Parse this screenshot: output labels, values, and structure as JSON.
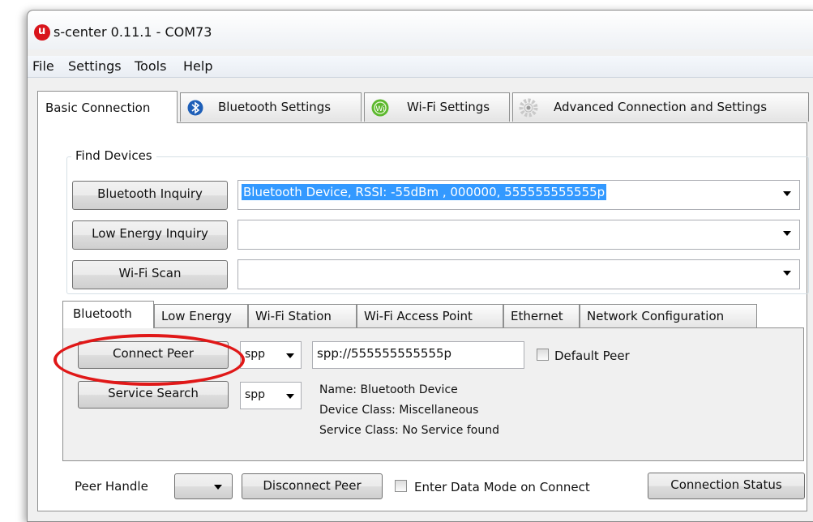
{
  "window": {
    "title": "s-center 0.11.1 - COM73"
  },
  "menu": [
    "File",
    "Settings",
    "Tools",
    "Help"
  ],
  "tabs": [
    {
      "label": "Basic Connection",
      "icon": ""
    },
    {
      "label": "Bluetooth Settings",
      "icon": "bluetooth-icon"
    },
    {
      "label": "Wi-Fi Settings",
      "icon": "wifi-icon"
    },
    {
      "label": "Advanced Connection and Settings",
      "icon": "gear-icon"
    }
  ],
  "find_devices": {
    "legend": "Find Devices",
    "bluetooth_inquiry": {
      "button": "Bluetooth Inquiry",
      "value": "Bluetooth Device, RSSI: -55dBm , 000000, 555555555555p"
    },
    "low_energy_inquiry": {
      "button": "Low Energy Inquiry",
      "value": ""
    },
    "wifi_scan": {
      "button": "Wi-Fi Scan",
      "value": ""
    }
  },
  "subtabs": [
    "Bluetooth",
    "Low Energy",
    "Wi-Fi Station",
    "Wi-Fi Access Point",
    "Ethernet",
    "Network Configuration"
  ],
  "bluetooth_panel": {
    "connect_peer_button": "Connect Peer",
    "connect_protocol": "spp",
    "peer_address": "spp://555555555555p",
    "default_peer_label": "Default Peer",
    "service_search_button": "Service Search",
    "search_protocol": "spp",
    "info": {
      "name": "Name: Bluetooth Device",
      "device_class": "Device Class: Miscellaneous",
      "service_class": "Service Class: No Service found"
    }
  },
  "bottom": {
    "peer_handle_label": "Peer Handle",
    "peer_handle_value": "",
    "disconnect_button": "Disconnect Peer",
    "enter_data_mode_label": "Enter Data Mode on Connect",
    "connection_status_button": "Connection Status"
  },
  "colors": {
    "highlight": "#3399ff",
    "annotation_circle": "#e01818"
  }
}
